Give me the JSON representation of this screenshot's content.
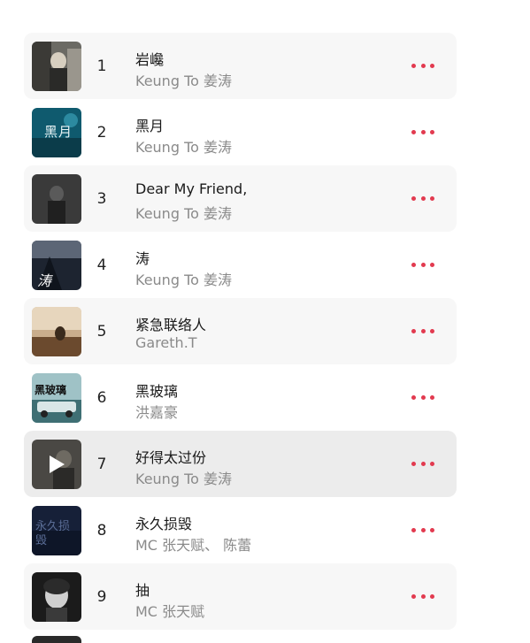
{
  "tracks": [
    {
      "rank": "1",
      "title": "岩巉",
      "artist": "Keung To 姜涛",
      "art_text": ""
    },
    {
      "rank": "2",
      "title": "黑月",
      "artist": "Keung To 姜涛",
      "art_text": "黑月"
    },
    {
      "rank": "3",
      "title": "Dear My Friend,",
      "artist": "Keung To 姜涛",
      "art_text": ""
    },
    {
      "rank": "4",
      "title": "涛",
      "artist": "Keung To 姜涛",
      "art_text": "涛"
    },
    {
      "rank": "5",
      "title": "紧急联络人",
      "artist": "Gareth.T",
      "art_text": ""
    },
    {
      "rank": "6",
      "title": "黑玻璃",
      "artist": "洪嘉豪",
      "art_text": "黑玻璃"
    },
    {
      "rank": "7",
      "title": "好得太过份",
      "artist": "Keung To 姜涛",
      "art_text": ""
    },
    {
      "rank": "8",
      "title": "永久损毁",
      "artist": "MC 张天赋、 陈蕾",
      "art_text": "永久损毁"
    },
    {
      "rank": "9",
      "title": "抽",
      "artist": "MC 张天赋",
      "art_text": ""
    }
  ],
  "icons": {
    "more": "more-dots-icon",
    "play": "play-icon"
  },
  "colors": {
    "accent": "#e23a4f",
    "title": "#1a1a1a",
    "artist": "#8a8a8a",
    "row_alt": "#f7f7f7",
    "row_active": "#ececec"
  }
}
